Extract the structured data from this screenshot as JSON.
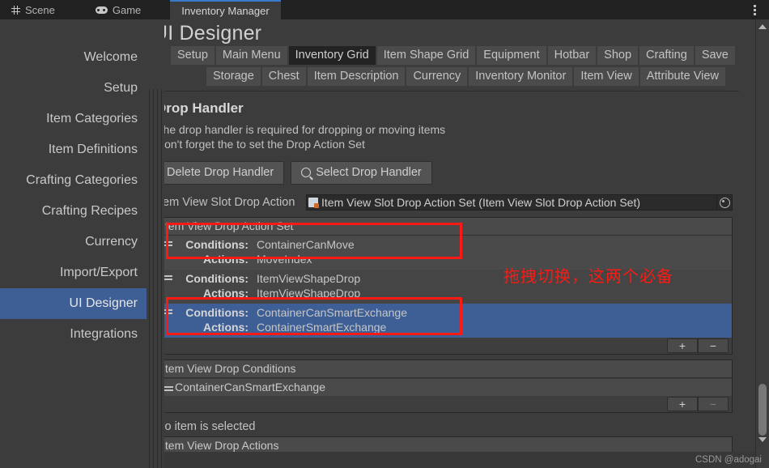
{
  "window": {
    "tabs": [
      {
        "label": "Scene",
        "icon": "grid-icon",
        "active": false
      },
      {
        "label": "Game",
        "icon": "gamepad-icon",
        "active": false
      },
      {
        "label": "Inventory Manager",
        "icon": "none",
        "active": true
      }
    ],
    "menu_icon": "kebab-menu-icon"
  },
  "sidebar": {
    "items": [
      {
        "label": "Welcome",
        "active": false
      },
      {
        "label": "Setup",
        "active": false
      },
      {
        "label": "Item Categories",
        "active": false
      },
      {
        "label": "Item Definitions",
        "active": false
      },
      {
        "label": "Crafting Categories",
        "active": false
      },
      {
        "label": "Crafting Recipes",
        "active": false
      },
      {
        "label": "Currency",
        "active": false
      },
      {
        "label": "Import/Export",
        "active": false
      },
      {
        "label": "UI Designer",
        "active": true
      },
      {
        "label": "Integrations",
        "active": false
      }
    ],
    "active_color": "#3e5f96"
  },
  "main": {
    "title": "UI Designer",
    "tab_row_1": [
      {
        "label": "Setup",
        "selected": false
      },
      {
        "label": "Main Menu",
        "selected": false
      },
      {
        "label": "Inventory Grid",
        "selected": true
      },
      {
        "label": "Item Shape Grid",
        "selected": false
      },
      {
        "label": "Equipment",
        "selected": false
      },
      {
        "label": "Hotbar",
        "selected": false
      },
      {
        "label": "Shop",
        "selected": false
      },
      {
        "label": "Crafting",
        "selected": false
      },
      {
        "label": "Save",
        "selected": false
      }
    ],
    "tab_row_2": [
      {
        "label": "Storage",
        "selected": false
      },
      {
        "label": "Chest",
        "selected": false
      },
      {
        "label": "Item Description",
        "selected": false
      },
      {
        "label": "Currency",
        "selected": false
      },
      {
        "label": "Inventory Monitor",
        "selected": false
      },
      {
        "label": "Item View",
        "selected": false
      },
      {
        "label": "Attribute View",
        "selected": false
      }
    ]
  },
  "inspector": {
    "heading": "Drop Handler",
    "description_line_1": "The drop handler is required for dropping or moving items",
    "description_line_2": "Don't forget the to set the Drop Action Set",
    "delete_button": "Delete Drop Handler",
    "select_button": "Select Drop Handler",
    "object_field": {
      "label": "Item View Slot Drop Action",
      "value": "Item View Slot Drop Action Set (Item View Slot Drop Action Set)",
      "picker_icon": "object-picker-icon"
    },
    "action_set_list": {
      "header": "Item View Drop Action Set",
      "key_conditions": "Conditions:",
      "key_actions": "Actions:",
      "rows": [
        {
          "conditions": "ContainerCanMove",
          "actions": "MoveIndex",
          "selected": false,
          "highlighted": true
        },
        {
          "conditions": "ItemViewShapeDrop",
          "actions": "ItemViewShapeDrop",
          "selected": false,
          "highlighted": false
        },
        {
          "conditions": "ContainerCanSmartExchange",
          "actions": "ContainerSmartExchange",
          "selected": true,
          "highlighted": true
        }
      ],
      "add_button": "+",
      "remove_button": "−"
    },
    "conditions_list": {
      "header": "Item View Drop Conditions",
      "rows": [
        "ContainerCanSmartExchange"
      ],
      "add_button": "+",
      "remove_button": "−"
    },
    "no_selection_text": "No item is selected",
    "actions_list": {
      "header": "Item View Drop Actions"
    }
  },
  "annotations": {
    "note_cn": "拖拽切换，这两个必备",
    "color": "#fb1a14"
  },
  "watermark": "CSDN @adogai"
}
